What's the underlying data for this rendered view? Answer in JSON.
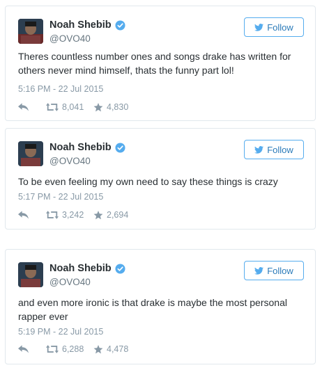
{
  "tweets": [
    {
      "name": "Noah Shebib",
      "handle": "@OVO40",
      "follow_label": "Follow",
      "text": "Theres countless number ones and songs drake has written for others never mind himself, thats the funny part lol!",
      "timestamp": "5:16 PM - 22 Jul 2015",
      "retweets": "8,041",
      "favorites": "4,830"
    },
    {
      "name": "Noah Shebib",
      "handle": "@OVO40",
      "follow_label": "Follow",
      "text": "To be even feeling my own need to say these things is crazy",
      "timestamp": "5:17 PM - 22 Jul 2015",
      "retweets": "3,242",
      "favorites": "2,694"
    },
    {
      "name": "Noah Shebib",
      "handle": "@OVO40",
      "follow_label": "Follow",
      "text": "and even more ironic is that drake is maybe the most personal rapper ever",
      "timestamp": "5:19 PM - 22 Jul 2015",
      "retweets": "6,288",
      "favorites": "4,478"
    }
  ],
  "icons": {
    "verified": "verified-badge-icon",
    "follow_bird": "twitter-bird-icon",
    "reply": "reply-icon",
    "retweet": "retweet-icon",
    "favorite": "star-icon"
  },
  "colors": {
    "accent": "#55acee",
    "follow_text": "#2b7bb9",
    "meta": "#8899a6",
    "handle": "#66757f",
    "border": "#e1e8ed"
  }
}
